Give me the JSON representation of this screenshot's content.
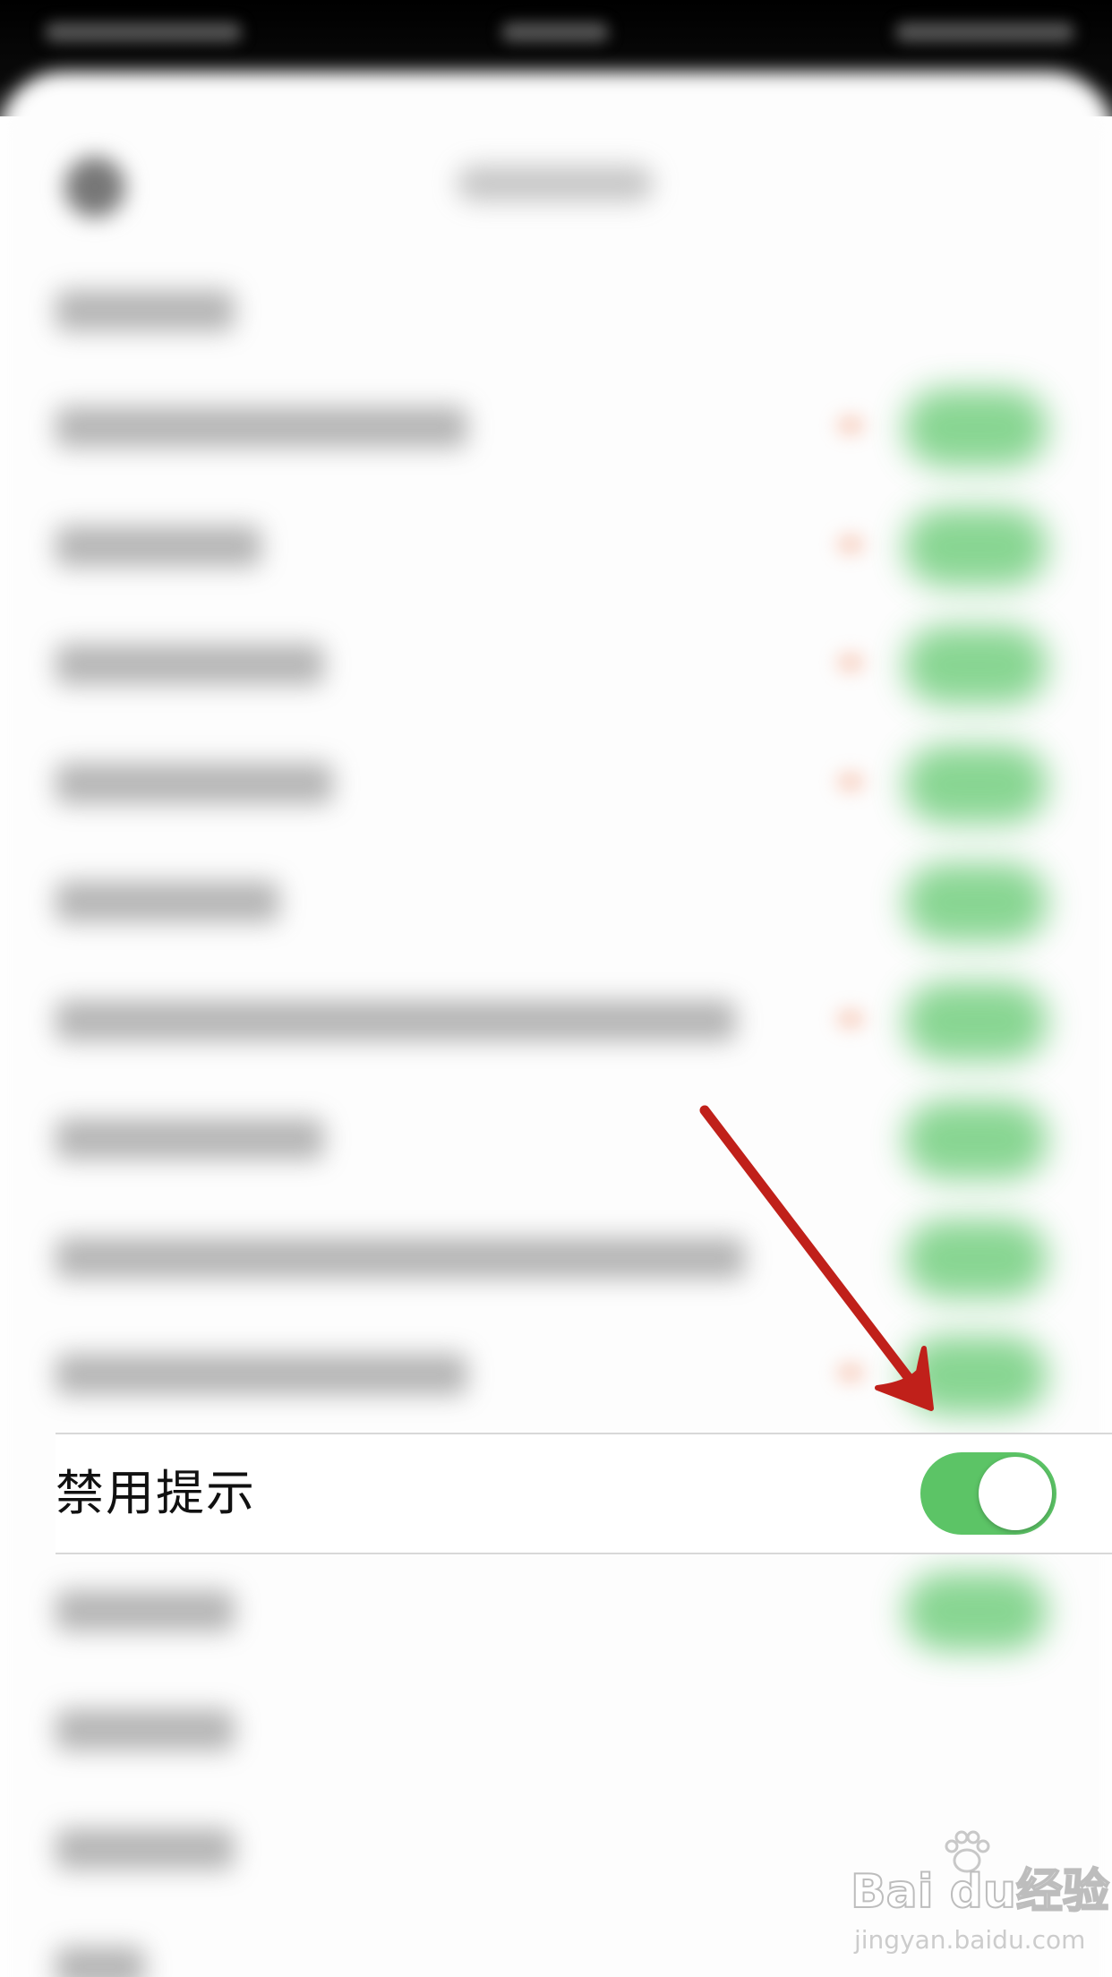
{
  "settings": {
    "highlighted_item": {
      "label": "禁用提示",
      "toggle_on": true
    }
  },
  "watermark": {
    "brand": "Bai du经验",
    "url": "jingyan.baidu.com"
  },
  "colors": {
    "toggle_on": "#5cc466",
    "arrow": "#c0201a",
    "status_bar": "#000000",
    "background": "#ffffff"
  }
}
